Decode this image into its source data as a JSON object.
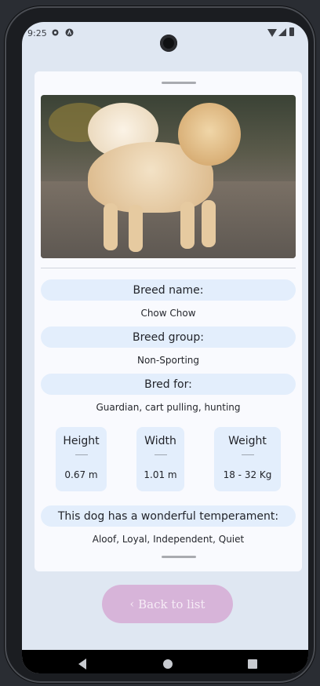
{
  "status_bar": {
    "time": "9:25",
    "settings_icon": "gear-icon",
    "app_icon": "a-icon",
    "wifi_icon": "wifi-icon",
    "signal_icon": "signal-icon",
    "battery_icon": "battery-icon"
  },
  "breed": {
    "name_label": "Breed name:",
    "name": "Chow Chow",
    "group_label": "Breed group:",
    "group": "Non-Sporting",
    "bred_for_label": "Bred for:",
    "bred_for": "Guardian, cart pulling, hunting"
  },
  "stats": {
    "height_label": "Height",
    "height_value": "0.67 m",
    "width_label": "Width",
    "width_value": "1.01 m",
    "weight_label": "Weight",
    "weight_value": "18 - 32 Kg"
  },
  "temperament": {
    "label": "This dog has a wonderful temperament:",
    "value": "Aloof, Loyal, Independent, Quiet"
  },
  "back_button": {
    "chevron": "‹",
    "label": "Back to list"
  },
  "colors": {
    "screen_bg": "#dfe7f2",
    "pill_bg": "#e3eefc",
    "button_bg": "#d7b4d9"
  }
}
